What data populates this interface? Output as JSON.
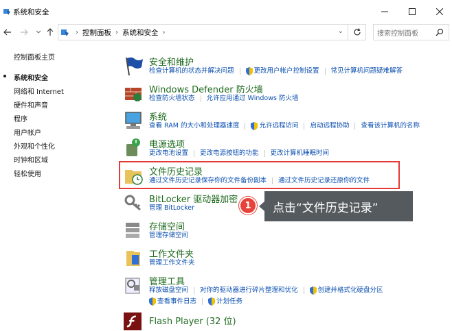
{
  "window": {
    "title": "系统和安全"
  },
  "address": {
    "crumbs": [
      "控制面板",
      "系统和安全"
    ]
  },
  "search": {
    "placeholder": "搜索控制面板"
  },
  "sidebar": {
    "home": "控制面板主页",
    "items": [
      {
        "label": "系统和安全",
        "active": true
      },
      {
        "label": "网络和 Internet"
      },
      {
        "label": "硬件和声音"
      },
      {
        "label": "程序"
      },
      {
        "label": "用户帐户"
      },
      {
        "label": "外观和个性化"
      },
      {
        "label": "时钟和区域"
      },
      {
        "label": "轻松使用"
      }
    ]
  },
  "categories": [
    {
      "title": "安全和维护",
      "icon": "flag-icon",
      "links": [
        "检查计算机的状态并解决问题",
        "更改用户帐户控制设置",
        "常见计算机问题疑难解答"
      ]
    },
    {
      "title": "Windows Defender 防火墙",
      "icon": "firewall-icon",
      "links": [
        "检查防火墙状态",
        "允许应用通过 Windows 防火墙"
      ]
    },
    {
      "title": "系统",
      "icon": "computer-icon",
      "links": [
        "查看 RAM 的大小和处理器速度",
        "允许远程访问",
        "启动远程协助",
        "查看该计算机的名称"
      ]
    },
    {
      "title": "电源选项",
      "icon": "power-icon",
      "links": [
        "更改电池设置",
        "更改电源按钮的功能",
        "更改计算机睡眠时间"
      ]
    },
    {
      "title": "文件历史记录",
      "icon": "file-history-icon",
      "links": [
        "通过文件历史记录保存你的文件备份副本",
        "通过文件历史记录还原你的文件"
      ]
    },
    {
      "title": "BitLocker 驱动器加密",
      "icon": "bitlocker-icon",
      "links": [
        "管理 BitLocker"
      ]
    },
    {
      "title": "存储空间",
      "icon": "storage-icon",
      "links": [
        "管理存储空间"
      ]
    },
    {
      "title": "工作文件夹",
      "icon": "work-folders-icon",
      "links": [
        "管理工作文件夹"
      ]
    },
    {
      "title": "管理工具",
      "icon": "admin-tools-icon",
      "links": [
        "释放磁盘空间",
        "对你的驱动器进行碎片整理和优化",
        "创建并格式化硬盘分区"
      ],
      "links2": [
        "查看事件日志",
        "计划任务"
      ]
    },
    {
      "title": "Flash Player (32 位)",
      "icon": "flash-icon",
      "links": []
    }
  ],
  "callout": {
    "number": "1",
    "text": "点击“文件历史记录”"
  },
  "colors": {
    "title_green": "#1e6b1e",
    "link_blue": "#0b4fb0",
    "highlight_red": "#e53935",
    "callout_bg": "#555a5e"
  }
}
